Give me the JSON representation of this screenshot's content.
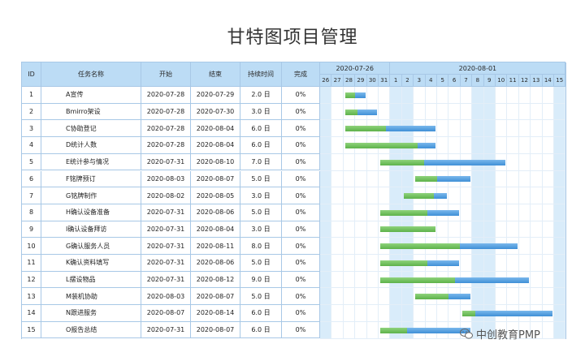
{
  "title": "甘特图项目管理",
  "columns": {
    "id": "ID",
    "name": "任务名称",
    "start": "开始",
    "end": "结束",
    "duration": "持续时间",
    "complete": "完成"
  },
  "timeline": {
    "weeks": [
      "2020-07-26",
      "2020-08-01"
    ],
    "days": [
      "26",
      "27",
      "28",
      "29",
      "30",
      "31",
      "1",
      "2",
      "3",
      "4",
      "5",
      "6",
      "7",
      "8",
      "9",
      "10",
      "11",
      "12",
      "13",
      "14",
      "15"
    ],
    "weekend_day_indices": [
      0,
      6,
      7,
      13,
      14,
      20
    ]
  },
  "tasks": [
    {
      "id": "1",
      "name": "A宣传",
      "start": "2020-07-28",
      "end": "2020-07-29",
      "duration": "2.0 日",
      "complete": "0%",
      "bar_start_day": 2,
      "bar_days": 2,
      "green_fraction": 0.5
    },
    {
      "id": "2",
      "name": "Bmirro架设",
      "start": "2020-07-28",
      "end": "2020-07-30",
      "duration": "3.0 日",
      "complete": "0%",
      "bar_start_day": 2,
      "bar_days": 3,
      "green_fraction": 0.4
    },
    {
      "id": "3",
      "name": "C协助登记",
      "start": "2020-07-28",
      "end": "2020-08-04",
      "duration": "6.0 日",
      "complete": "0%",
      "bar_start_day": 2,
      "bar_days": 8,
      "green_fraction": 0.45
    },
    {
      "id": "4",
      "name": "D统计人数",
      "start": "2020-07-28",
      "end": "2020-08-04",
      "duration": "6.0 日",
      "complete": "0%",
      "bar_start_day": 2,
      "bar_days": 8,
      "green_fraction": 0.8
    },
    {
      "id": "5",
      "name": "E统计参与情况",
      "start": "2020-07-31",
      "end": "2020-08-10",
      "duration": "7.0 日",
      "complete": "0%",
      "bar_start_day": 5,
      "bar_days": 11,
      "green_fraction": 0.35
    },
    {
      "id": "6",
      "name": "F铭牌预订",
      "start": "2020-08-03",
      "end": "2020-08-07",
      "duration": "5.0 日",
      "complete": "0%",
      "bar_start_day": 8,
      "bar_days": 5,
      "green_fraction": 0.4
    },
    {
      "id": "7",
      "name": "G铭牌制作",
      "start": "2020-08-02",
      "end": "2020-08-05",
      "duration": "3.0 日",
      "complete": "0%",
      "bar_start_day": 7,
      "bar_days": 4,
      "green_fraction": 0.7
    },
    {
      "id": "8",
      "name": "H确认设备准备",
      "start": "2020-07-31",
      "end": "2020-08-06",
      "duration": "5.0 日",
      "complete": "0%",
      "bar_start_day": 5,
      "bar_days": 7,
      "green_fraction": 0.6
    },
    {
      "id": "9",
      "name": "I确认设备拜访",
      "start": "2020-07-31",
      "end": "2020-08-04",
      "duration": "3.0 日",
      "complete": "0%",
      "bar_start_day": 5,
      "bar_days": 5,
      "green_fraction": 1.0
    },
    {
      "id": "10",
      "name": "G确认服务人员",
      "start": "2020-07-31",
      "end": "2020-08-11",
      "duration": "8.0 日",
      "complete": "0%",
      "bar_start_day": 5,
      "bar_days": 12,
      "green_fraction": 0.58
    },
    {
      "id": "11",
      "name": "K确认资料填写",
      "start": "2020-07-31",
      "end": "2020-08-06",
      "duration": "5.0 日",
      "complete": "0%",
      "bar_start_day": 5,
      "bar_days": 7,
      "green_fraction": 0.6
    },
    {
      "id": "12",
      "name": "L摆设物品",
      "start": "2020-07-31",
      "end": "2020-08-12",
      "duration": "9.0 日",
      "complete": "0%",
      "bar_start_day": 5,
      "bar_days": 13,
      "green_fraction": 0.5
    },
    {
      "id": "13",
      "name": "M装机协助",
      "start": "2020-08-03",
      "end": "2020-08-07",
      "duration": "5.0 日",
      "complete": "0%",
      "bar_start_day": 8,
      "bar_days": 5,
      "green_fraction": 0.6
    },
    {
      "id": "14",
      "name": "N跟进服务",
      "start": "2020-08-07",
      "end": "2020-08-14",
      "duration": "6.0 日",
      "complete": "0%",
      "bar_start_day": 12,
      "bar_days": 8,
      "green_fraction": 0.15
    },
    {
      "id": "15",
      "name": "O报告总结",
      "start": "2020-07-31",
      "end": "2020-08-07",
      "duration": "6.0 日",
      "complete": "0%",
      "bar_start_day": 5,
      "bar_days": 8,
      "green_fraction": 0.3
    }
  ],
  "colors": {
    "header_bg": "#bcdcf5",
    "weekend_bg": "#d9ecfa",
    "bar_done": "#5db24a",
    "bar_rest": "#3f8fd6",
    "grid_line": "#a8c8e6"
  },
  "watermark": "中创教育PMP"
}
